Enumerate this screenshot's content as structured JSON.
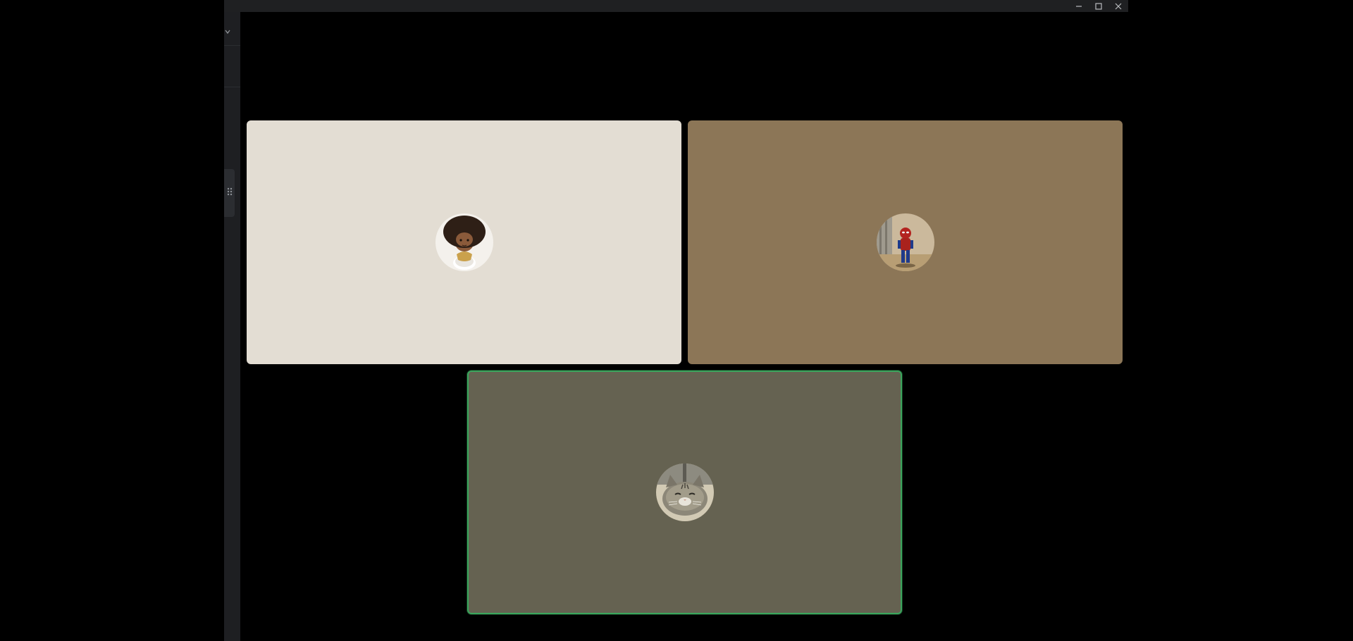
{
  "window": {
    "controls": [
      {
        "name": "minimize-button",
        "icon": "minimize-icon"
      },
      {
        "name": "maximize-button",
        "icon": "maximize-icon"
      },
      {
        "name": "close-button",
        "icon": "close-icon"
      }
    ]
  },
  "sidebar": {
    "collapse_icon": "chevron-down-icon",
    "handle_icon": "drag-handle-icon"
  },
  "call": {
    "participants": [
      {
        "tile_color": "#e3ddd3",
        "avatar": "afro-doll-avatar",
        "speaking": false
      },
      {
        "tile_color": "#8c7657",
        "avatar": "spiderman-toy-avatar",
        "speaking": false
      },
      {
        "tile_color": "#656251",
        "avatar": "cat-avatar",
        "speaking": true
      }
    ],
    "speaking_color": "#3ba55d"
  }
}
